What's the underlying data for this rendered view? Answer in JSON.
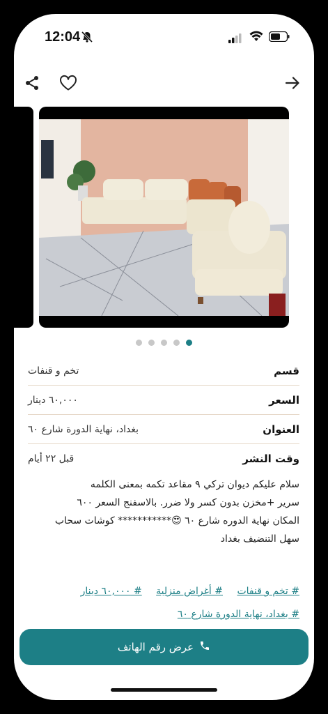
{
  "status_bar": {
    "time": "12:04"
  },
  "listing": {
    "rows": [
      {
        "label": "قسم",
        "value": "تخم و قنفات"
      },
      {
        "label": "السعر",
        "value": "٦٠,٠٠٠ دينار"
      },
      {
        "label": "العنوان",
        "value": "بغداد، نهاية الدورة شارع ٦٠"
      },
      {
        "label": "وقت النشر",
        "value": "قبل ٢٢ أيام"
      }
    ],
    "description_lines": [
      "سلام عليكم  ديوان تركي  ٩ مقاعد تكمه بمعنى الكلمه",
      "سرير +مخزن  بدون كسر ولا ضرر. بالاسفنج السعر ٦٠٠",
      "المكان نهاية  الدوره شارع ٦٠    😍***********  كوشات سحاب",
      "سهل التنضيف بغداد"
    ],
    "tags_line1": [
      "# تخم و قنفات",
      "# أغراض منزلية",
      "# ٦٠,٠٠٠ دينار"
    ],
    "tags_line2": [
      "# بغداد، نهاية الدورة شارع ٦٠"
    ]
  },
  "gallery": {
    "total": 5,
    "active": 4
  },
  "actions": {
    "call_label": "عرض رقم الهاتف"
  },
  "colors": {
    "accent": "#1d7f86",
    "divider": "#e6d8c8"
  },
  "icons": [
    "share-icon",
    "heart-icon",
    "back-arrow-icon",
    "phone-icon"
  ]
}
